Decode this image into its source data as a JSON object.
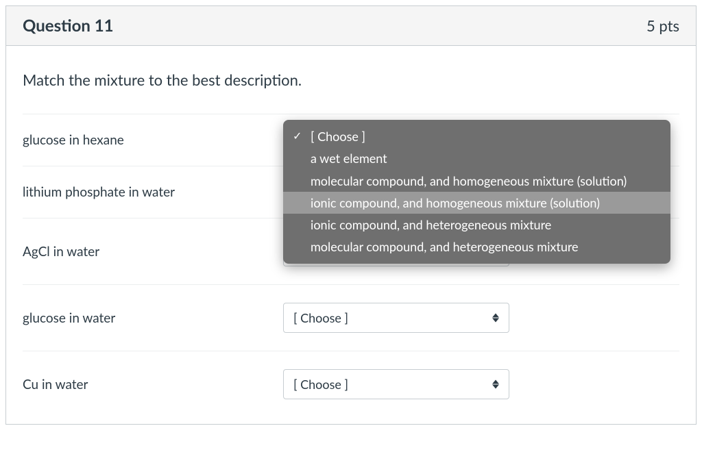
{
  "header": {
    "title": "Question 11",
    "points": "5 pts"
  },
  "prompt": "Match the mixture to the best description.",
  "select_placeholder": "[ Choose ]",
  "rows": [
    {
      "label": "glucose in hexane"
    },
    {
      "label": "lithium phosphate in water"
    },
    {
      "label": "AgCl in water"
    },
    {
      "label": "glucose in water"
    },
    {
      "label": "Cu in water"
    }
  ],
  "dropdown": {
    "checked_index": 0,
    "highlight_index": 3,
    "options": [
      "[ Choose ]",
      "a wet element",
      "molecular compound, and homogeneous mixture (solution)",
      "ionic compound, and homogeneous mixture (solution)",
      "ionic compound, and heterogeneous mixture",
      "molecular compound, and heterogeneous mixture"
    ]
  }
}
